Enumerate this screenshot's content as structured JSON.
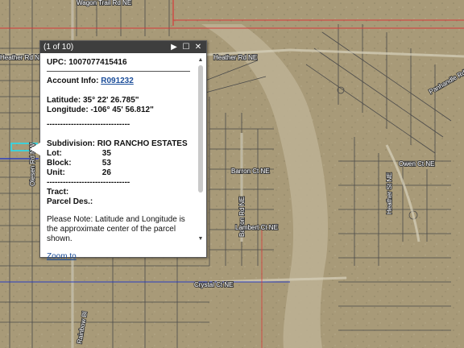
{
  "popup": {
    "count_label": "(1 of 10)",
    "upc_label": "UPC:",
    "upc_value": "1007077415416",
    "account_label": "Account Info:",
    "account_value": "R091232",
    "latitude_label": "Latitude:",
    "latitude_value": "35° 22' 26.785\"",
    "longitude_label": "Longitude:",
    "longitude_value": "-106° 45' 56.812\"",
    "divider": "-------------------------------",
    "subdivision_label": "Subdivision:",
    "subdivision_value": "RIO RANCHO ESTATES",
    "lot_label": "Lot:",
    "lot_value": "35",
    "block_label": "Block:",
    "block_value": "53",
    "unit_label": "Unit:",
    "unit_value": "26",
    "divider2": "-------------------------------",
    "tract_label": "Tract:",
    "parcel_des_label": "Parcel Des.:",
    "note": "Please Note: Latitude and Longitude is the approximate center of the parcel shown.",
    "zoom_link": "Zoom to"
  },
  "streets": {
    "heather_rd": "Heather Rd NE",
    "heather_rd_left": "Heather Rd NW",
    "barron_ct": "Barron Ct NE",
    "barron_rd": "Barron Rd NE",
    "lambert_ct": "Lambert Ct NE",
    "crystal_ct": "Crystal Ct NE",
    "owen_ct": "Owen Ct NE",
    "heather_st": "Heather St NE",
    "ponderosa": "Panhandle Rd NE",
    "rainbow": "Rainbow Bl",
    "olesen": "Olesen Rd NW",
    "top_street": "Wagon Trail Rd NE"
  },
  "colors": {
    "terrain": "#a89a78",
    "parcel_lines": "#4a4a4a",
    "selected_parcel": "#3fd0d8",
    "boundary_red": "#d83a3a",
    "boundary_blue": "#2a3ec0",
    "popup_header": "#3e3e3e"
  }
}
